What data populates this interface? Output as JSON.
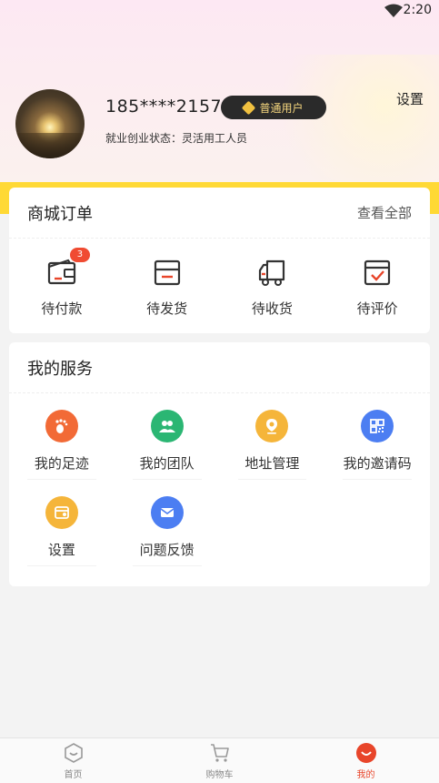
{
  "status_bar": {
    "time": "2:20"
  },
  "profile": {
    "phone": "185****2157",
    "badge": "普通用户",
    "employment_status": "就业创业状态：灵活用工人员",
    "settings_label": "设置"
  },
  "orders": {
    "title": "商城订单",
    "view_all": "查看全部",
    "items": [
      {
        "label": "待付款",
        "icon": "wallet-icon",
        "count": "3"
      },
      {
        "label": "待发货",
        "icon": "box-icon"
      },
      {
        "label": "待收货",
        "icon": "truck-icon"
      },
      {
        "label": "待评价",
        "icon": "review-box-icon"
      }
    ]
  },
  "services": {
    "title": "我的服务",
    "items": [
      {
        "label": "我的足迹",
        "icon": "footprint-icon",
        "color": "#f26a36"
      },
      {
        "label": "我的团队",
        "icon": "team-icon",
        "color": "#2bb673"
      },
      {
        "label": "地址管理",
        "icon": "location-icon",
        "color": "#f5b53a"
      },
      {
        "label": "我的邀请码",
        "icon": "qrcode-icon",
        "color": "#4c7ef2"
      },
      {
        "label": "设置",
        "icon": "settings-icon",
        "color": "#f5b53a"
      },
      {
        "label": "问题反馈",
        "icon": "mail-icon",
        "color": "#4c7ef2"
      }
    ]
  },
  "tabbar": {
    "items": [
      {
        "label": "首页",
        "icon": "home-icon"
      },
      {
        "label": "购物车",
        "icon": "cart-icon"
      },
      {
        "label": "我的",
        "icon": "profile-icon",
        "active": true
      }
    ]
  },
  "colors": {
    "accent": "#e8452a",
    "yellow_band": "#ffd935",
    "badge_bg": "#2a2a2a",
    "badge_text": "#f4d57d"
  }
}
